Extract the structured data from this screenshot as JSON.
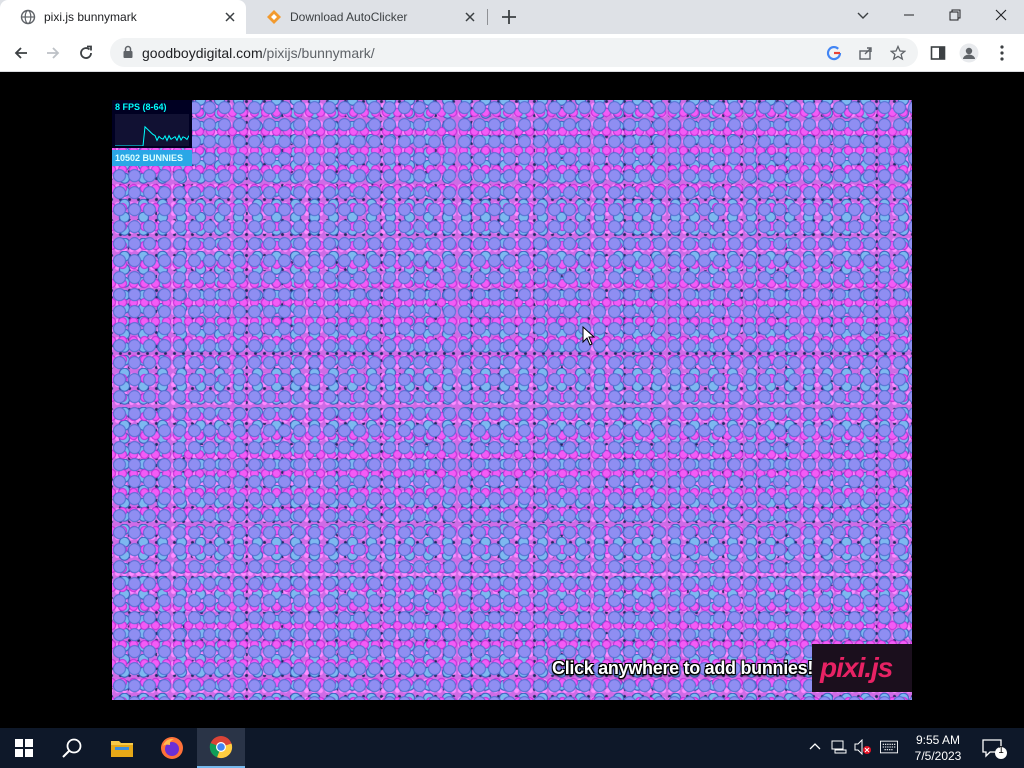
{
  "browser": {
    "tabs": [
      {
        "title": "pixi.js bunnymark",
        "active": true,
        "icon": "globe-icon"
      },
      {
        "title": "Download AutoClicker",
        "active": false,
        "icon": "autoclicker-diamond-icon"
      }
    ],
    "address_bar": {
      "domain": "goodboydigital.com",
      "path": "/pixijs/bunnymark/"
    }
  },
  "canvas": {
    "fps_text": "8 FPS (8-64)",
    "bunny_count_text": "10502 BUNNIES",
    "fps_graph_level": 0.25,
    "cta_text": "Click anywhere to add bunnies!",
    "logo_text": "pixi.js",
    "colors": {
      "bunny_magenta": "#e04cf0",
      "bunny_blue": "#5a7ee0",
      "logo_pink": "#e72264",
      "stats_cyan": "#00ffff"
    }
  },
  "taskbar": {
    "apps": [
      "start-icon",
      "search-icon",
      "file-explorer-icon",
      "firefox-icon",
      "chrome-icon"
    ],
    "clock": {
      "time": "9:55 AM",
      "date": "7/5/2023"
    },
    "notification_count": "1"
  }
}
